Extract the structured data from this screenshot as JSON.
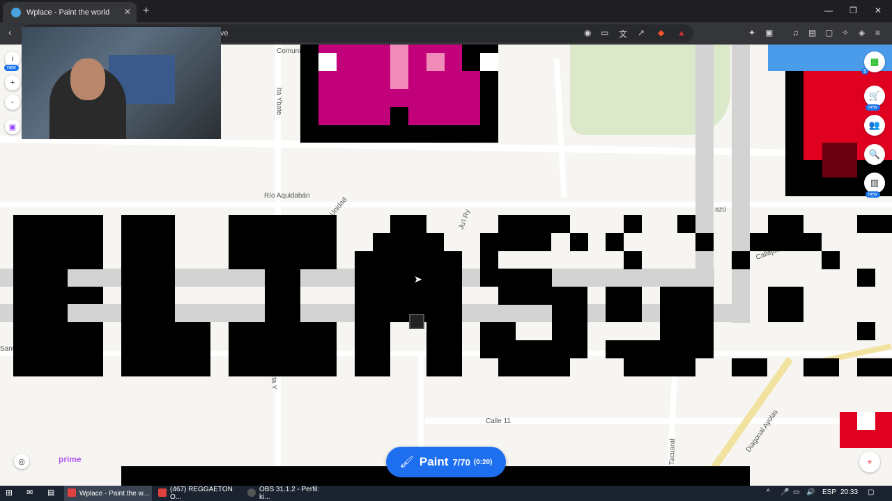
{
  "browser": {
    "tab_title": "Wplace - Paint the world",
    "tab_close": "✕",
    "new_tab": "+",
    "address_fragment": "ve",
    "window_controls": {
      "minimize": "—",
      "maximize": "❐",
      "close": "✕"
    }
  },
  "map": {
    "labels": {
      "comunidad": "Comunidad",
      "ita_ybate": "Ita Ybate",
      "rio": "Río Aquidabán",
      "unidad": "Unidad",
      "ju_i_ry": "Ju'i Ry",
      "azu": "azú",
      "callejon": "Callejón",
      "calle11": "Calle 11",
      "ita_y": "Ita Y",
      "tacuaral": "Tacuaral",
      "diagonal": "Diagonal Ayolas",
      "santa": "Sant"
    }
  },
  "left_controls": {
    "info": "i",
    "new_badge": "new",
    "zoom_in": "+",
    "zoom_out": "-"
  },
  "right_controls": {
    "badge_count": "5",
    "new_badge": "new"
  },
  "paint_button": {
    "label": "Paint",
    "count": "7/70",
    "timer": "(0:20)"
  },
  "overlay": {
    "brand": "prime"
  },
  "taskbar": {
    "items": [
      {
        "label": "Wplace - Paint the w...",
        "color": "#e04040"
      },
      {
        "label": "(467) REGGAETON O...",
        "color": "#e04040"
      },
      {
        "label": "OBS 31.1.2 - Perfil: ki...",
        "color": "#555555"
      }
    ],
    "lang": "ESP",
    "time": "20:33"
  }
}
